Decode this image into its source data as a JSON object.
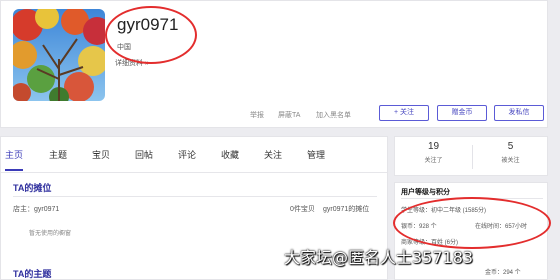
{
  "profile": {
    "username": "gyr0971",
    "location": "中国",
    "details_link": "详细资料 »"
  },
  "actions": {
    "report": "举报",
    "block": "屏蔽TA",
    "blacklist": "加入黑名单",
    "follow": "+ 关注",
    "gift_coin": "赠金币",
    "message": "发私信"
  },
  "tabs": [
    "主页",
    "主题",
    "宝贝",
    "回帖",
    "评论",
    "收藏",
    "关注",
    "管理"
  ],
  "shop": {
    "title": "TA的摊位",
    "owner_label": "店主：gyr0971",
    "item_count": "0件宝贝",
    "shop_name": "gyr0971的摊位",
    "empty_note": "暂无使用的橱窗"
  },
  "topics": {
    "title": "TA的主题"
  },
  "stats": {
    "following_count": "19",
    "following_label": "关注了",
    "followers_count": "5",
    "followers_label": "被关注"
  },
  "level": {
    "title": "用户等级与积分",
    "student_level": "学生等级：初中二年级 (1585分)",
    "coins": "银币：928 个",
    "online_time": "在线时间：657小时",
    "merchant_level": "商家等级：百姓 (6分)",
    "gold_coin_row": "金币：294 个"
  },
  "watermark": "大家坛@匿名人士357183",
  "colors": {
    "accent": "#3b3bb8",
    "highlight_circle": "#e32d2d"
  }
}
